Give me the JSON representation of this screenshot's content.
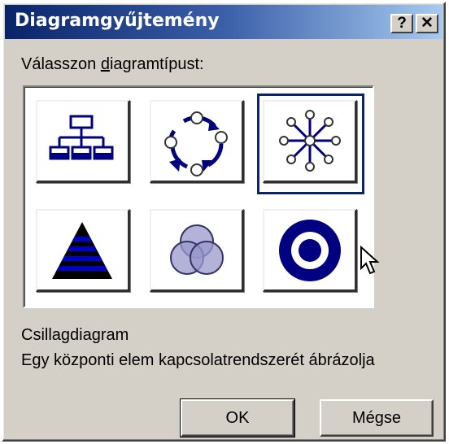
{
  "window": {
    "title": "Diagramgyűjtemény",
    "help_label": "?",
    "close_label": "✕"
  },
  "prompt": {
    "before": "Válasszon ",
    "mnemonic": "d",
    "after": "iagramtípust:"
  },
  "gallery": {
    "items": [
      {
        "icon": "organization-chart-icon"
      },
      {
        "icon": "cycle-diagram-icon"
      },
      {
        "icon": "radial-diagram-icon",
        "selected": true
      },
      {
        "icon": "pyramid-diagram-icon"
      },
      {
        "icon": "venn-diagram-icon"
      },
      {
        "icon": "target-diagram-icon"
      }
    ]
  },
  "description": {
    "name": "Csillagdiagram",
    "text": "Egy központi elem kapcsolatrendszerét ábrázolja"
  },
  "buttons": {
    "ok": "OK",
    "cancel": "Mégse"
  },
  "colors": {
    "titlebar_start": "#0a246a",
    "titlebar_end": "#a6caf0",
    "diagram_blue": "#000080",
    "venn_fill": "#9999cc"
  }
}
